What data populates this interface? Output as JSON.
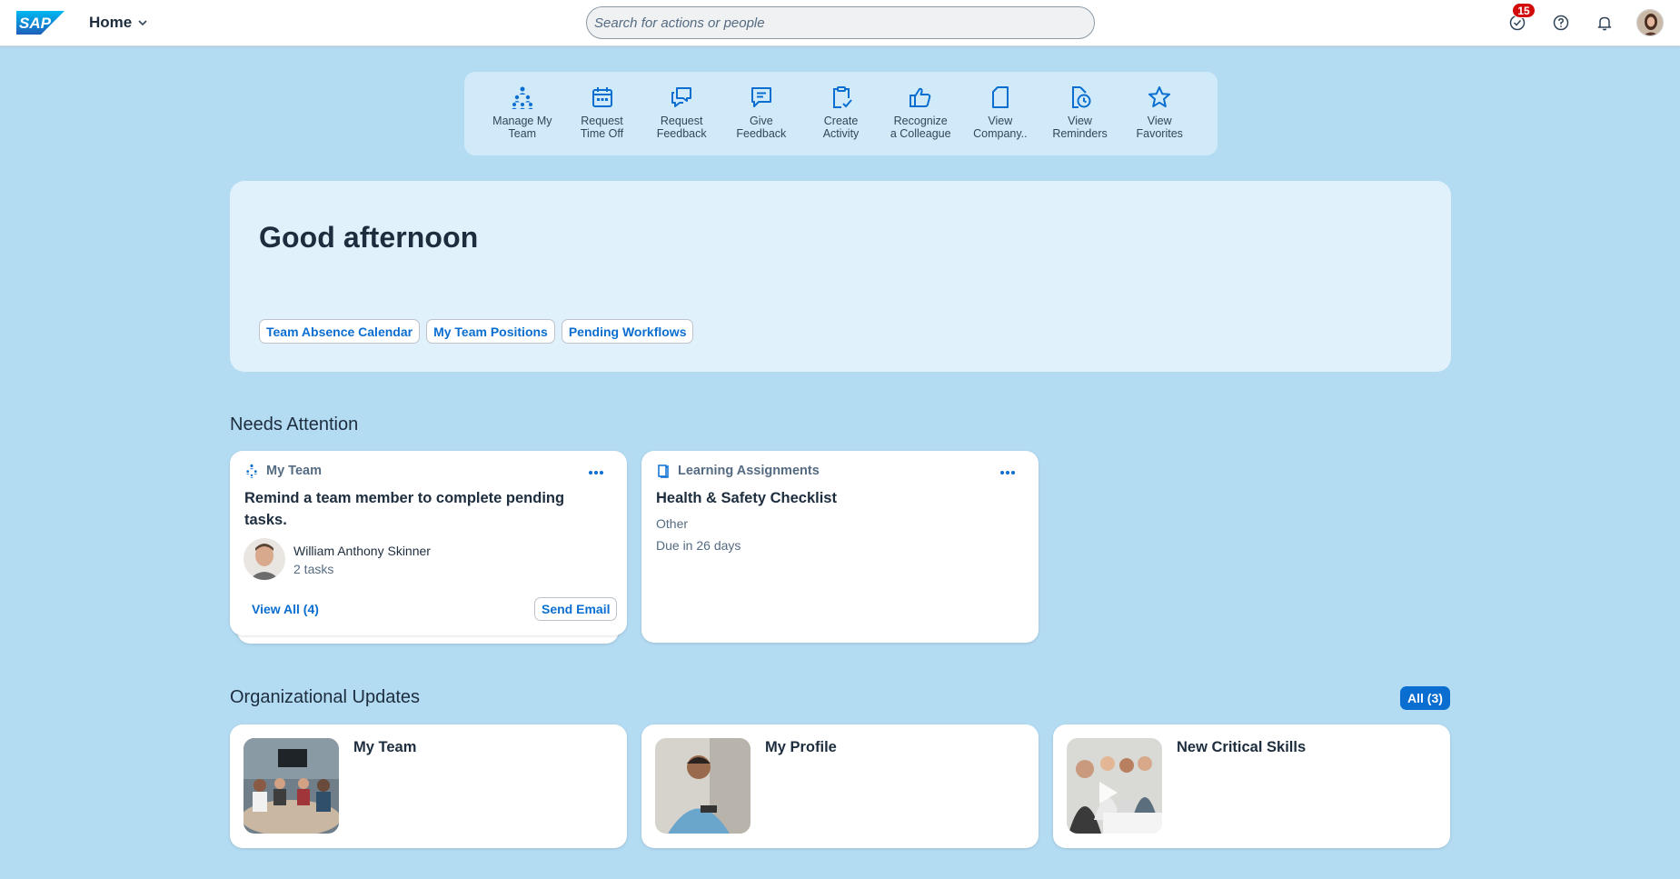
{
  "header": {
    "logo_text": "SAP",
    "home_label": "Home",
    "search_placeholder": "Search for actions or people",
    "tasks_badge": "15",
    "brand_color": "#0a6ed1"
  },
  "quick_actions": [
    {
      "label": "Manage My\nTeam",
      "icon": "org-chart-icon"
    },
    {
      "label": "Request\nTime Off",
      "icon": "calendar-icon"
    },
    {
      "label": "Request\nFeedback",
      "icon": "feedback-request-icon"
    },
    {
      "label": "Give\nFeedback",
      "icon": "comment-icon"
    },
    {
      "label": "Create\nActivity",
      "icon": "clipboard-check-icon"
    },
    {
      "label": "Recognize\na Colleague",
      "icon": "thumbs-up-icon"
    },
    {
      "label": "View\nCompany..",
      "icon": "document-icon"
    },
    {
      "label": "View\nReminders",
      "icon": "reminder-clock-icon"
    },
    {
      "label": "View\nFavorites",
      "icon": "star-icon"
    }
  ],
  "greeting": {
    "title": "Good afternoon",
    "links": [
      "Team Absence Calendar",
      "My Team Positions",
      "Pending Workflows"
    ]
  },
  "needs_attention": {
    "title": "Needs Attention",
    "cards": [
      {
        "category": "My Team",
        "title": "Remind a team member to complete pending tasks.",
        "person_name": "William Anthony Skinner",
        "person_detail": "2 tasks",
        "view_all": "View All (4)",
        "action": "Send Email"
      },
      {
        "category": "Learning Assignments",
        "title": "Health & Safety Checklist",
        "detail1": "Other",
        "detail2": "Due in 26 days"
      }
    ]
  },
  "org_updates": {
    "title": "Organizational Updates",
    "all_button": "All (3)",
    "cards": [
      {
        "title": "My Team"
      },
      {
        "title": "My Profile"
      },
      {
        "title": "New Critical Skills"
      }
    ]
  }
}
